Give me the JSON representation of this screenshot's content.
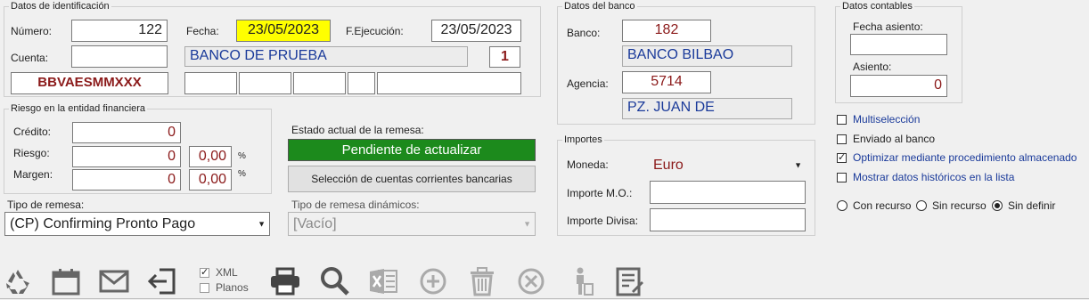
{
  "identificacion": {
    "legend": "Datos de identificación",
    "numero_label": "Número:",
    "numero_value": "122",
    "fecha_label": "Fecha:",
    "fecha_value": "23/05/2023",
    "fejec_label": "F.Ejecución:",
    "fejec_value": "23/05/2023",
    "cuenta_label": "Cuenta:",
    "cuenta_value": "",
    "cuenta_nombre": "BANCO DE PRUEBA",
    "cuenta_num": "1",
    "bic": "BBVAESMMXXX"
  },
  "banco": {
    "legend": "Datos del banco",
    "banco_label": "Banco:",
    "banco_value": "182",
    "banco_nombre": "BANCO BILBAO",
    "agencia_label": "Agencia:",
    "agencia_value": "5714",
    "agencia_nombre": "PZ. JUAN DE"
  },
  "contables": {
    "legend": "Datos contables",
    "fecha_asiento_label": "Fecha asiento:",
    "fecha_asiento_value": "",
    "asiento_label": "Asiento:",
    "asiento_value": "0"
  },
  "riesgo": {
    "legend": "Riesgo en la entidad financiera",
    "credito_label": "Crédito:",
    "credito_value": "0",
    "riesgo_label": "Riesgo:",
    "riesgo_value": "0",
    "riesgo_pct": "0,00",
    "margen_label": "Margen:",
    "margen_value": "0",
    "margen_pct": "0,00",
    "pct_symbol": "%"
  },
  "estado": {
    "label": "Estado actual de la remesa:",
    "value": "Pendiente de actualizar",
    "color": "#1c8a1c",
    "seleccion_button": "Selección de cuentas corrientes bancarias"
  },
  "tipo_remesa": {
    "label": "Tipo de remesa:",
    "value": "(CP) Confirming Pronto Pago"
  },
  "tipo_dinamico": {
    "label": "Tipo de remesa dinámicos:",
    "value": "[Vacío]"
  },
  "importes": {
    "legend": "Importes",
    "moneda_label": "Moneda:",
    "moneda_value": "Euro",
    "importe_mo_label": "Importe M.O.:",
    "importe_mo_value": "",
    "importe_divisa_label": "Importe Divisa:",
    "importe_divisa_value": ""
  },
  "opciones": {
    "multiseleccion": "Multiselección",
    "enviado": "Enviado al banco",
    "optimizar": "Optimizar mediante procedimiento almacenado",
    "historicos": "Mostrar datos históricos en la lista",
    "con_recurso": "Con recurso",
    "sin_recurso": "Sin recurso",
    "sin_definir": "Sin definir"
  },
  "toolbar": {
    "xml_label": "XML",
    "planos_label": "Planos",
    "icons": [
      "recycle-icon",
      "calendar-icon",
      "mail-icon",
      "exit-icon",
      "printer-icon",
      "search-icon",
      "excel-icon",
      "add-icon",
      "trash-icon",
      "cancel-icon",
      "user-trash-icon",
      "notes-icon"
    ]
  },
  "colors": {
    "fecha_highlight": "#ffff00",
    "value_red": "#8b1a1a",
    "link_blue": "#1a3a9a"
  }
}
